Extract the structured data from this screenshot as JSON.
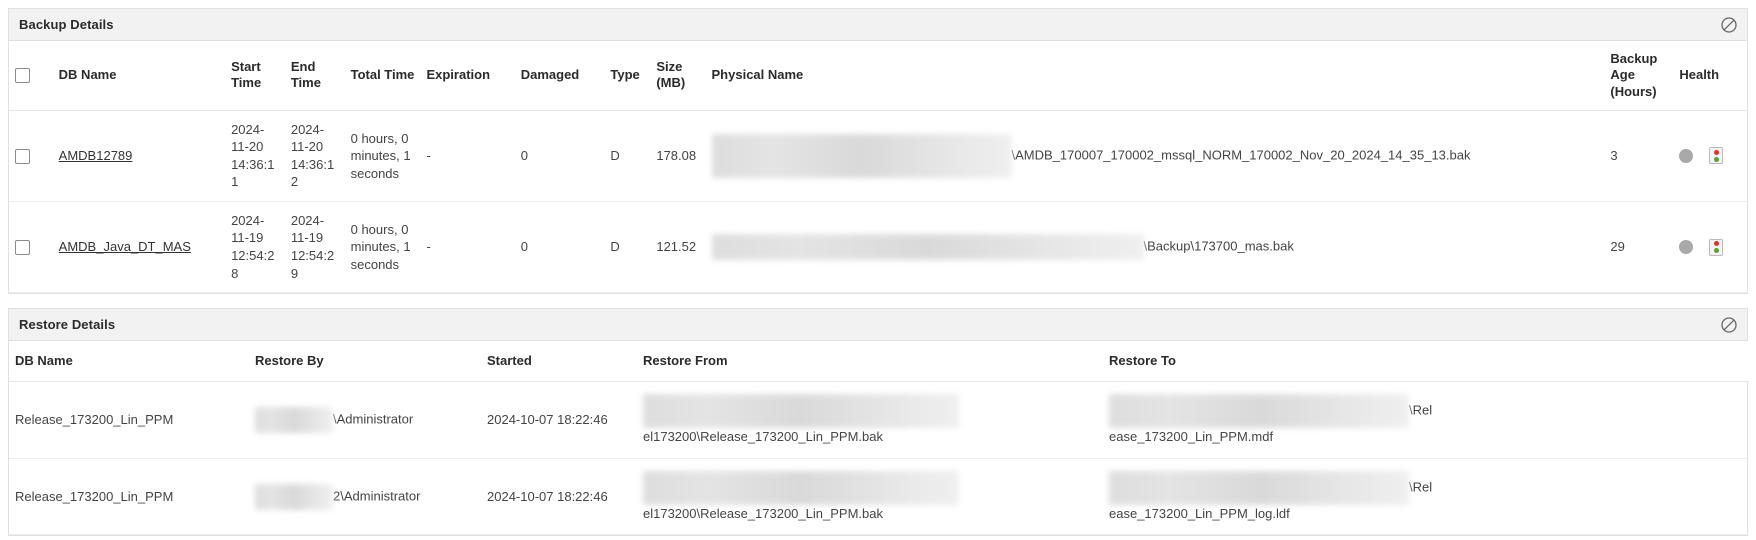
{
  "backup_panel": {
    "title": "Backup Details",
    "collapse_icon": "circle-slash-icon",
    "columns": {
      "select": "",
      "db_name": "DB Name",
      "start_time": "Start Time",
      "end_time": "End Time",
      "total_time": "Total Time",
      "expiration": "Expiration",
      "damaged": "Damaged",
      "type": "Type",
      "size": "Size (MB)",
      "physical_name": "Physical Name",
      "backup_age": "Backup Age (Hours)",
      "health": "Health"
    },
    "rows": [
      {
        "db_name": "AMDB12789",
        "start_time": "2024-11-20 14:36:11",
        "end_time": "2024-11-20 14:36:12",
        "total_time": "0 hours, 0 minutes, 1 seconds",
        "expiration": "-",
        "damaged": "0",
        "type": "D",
        "size": "178.08",
        "physical_name_visible": "\\AMDB_170007_170002_mssql_NORM_170002_Nov_20_2024_14_35_13.bak",
        "physical_name_redacted": true,
        "backup_age": "3",
        "health_status_dot": "#a9a9a9",
        "health_icon": "traffic-light-icon"
      },
      {
        "db_name": "AMDB_Java_DT_MAS",
        "start_time": "2024-11-19 12:54:28",
        "end_time": "2024-11-19 12:54:29",
        "total_time": "0 hours, 0 minutes, 1 seconds",
        "expiration": "-",
        "damaged": "0",
        "type": "D",
        "size": "121.52",
        "physical_name_visible": "\\Backup\\173700_mas.bak",
        "physical_name_redacted": true,
        "backup_age": "29",
        "health_status_dot": "#a9a9a9",
        "health_icon": "traffic-light-icon"
      }
    ]
  },
  "restore_panel": {
    "title": "Restore Details",
    "collapse_icon": "circle-slash-icon",
    "columns": {
      "db_name": "DB Name",
      "restore_by": "Restore By",
      "started": "Started",
      "restore_from": "Restore From",
      "restore_to": "Restore To"
    },
    "rows": [
      {
        "db_name": "Release_173200_Lin_PPM",
        "restore_by_visible": "\\Administrator",
        "restore_by_redacted": true,
        "started": "2024-10-07 18:22:46",
        "restore_from_visible": "el173200\\Release_173200_Lin_PPM.bak",
        "restore_from_redacted": true,
        "restore_to_tail": "\\Rel",
        "restore_to_visible": "ease_173200_Lin_PPM.mdf",
        "restore_to_redacted": true
      },
      {
        "db_name": "Release_173200_Lin_PPM",
        "restore_by_visible": "2\\Administrator",
        "restore_by_redacted": true,
        "started": "2024-10-07 18:22:46",
        "restore_from_visible": "el173200\\Release_173200_Lin_PPM.bak",
        "restore_from_redacted": true,
        "restore_to_tail": "\\Rel",
        "restore_to_visible": "ease_173200_Lin_PPM_log.ldf",
        "restore_to_redacted": true
      }
    ]
  },
  "colors": {
    "panel_header_bg": "#f2f2f2",
    "border": "#e0e0e0",
    "text": "#333333",
    "traffic_red": "#d9342b",
    "traffic_green": "#5aa02c",
    "status_gray": "#a9a9a9"
  }
}
